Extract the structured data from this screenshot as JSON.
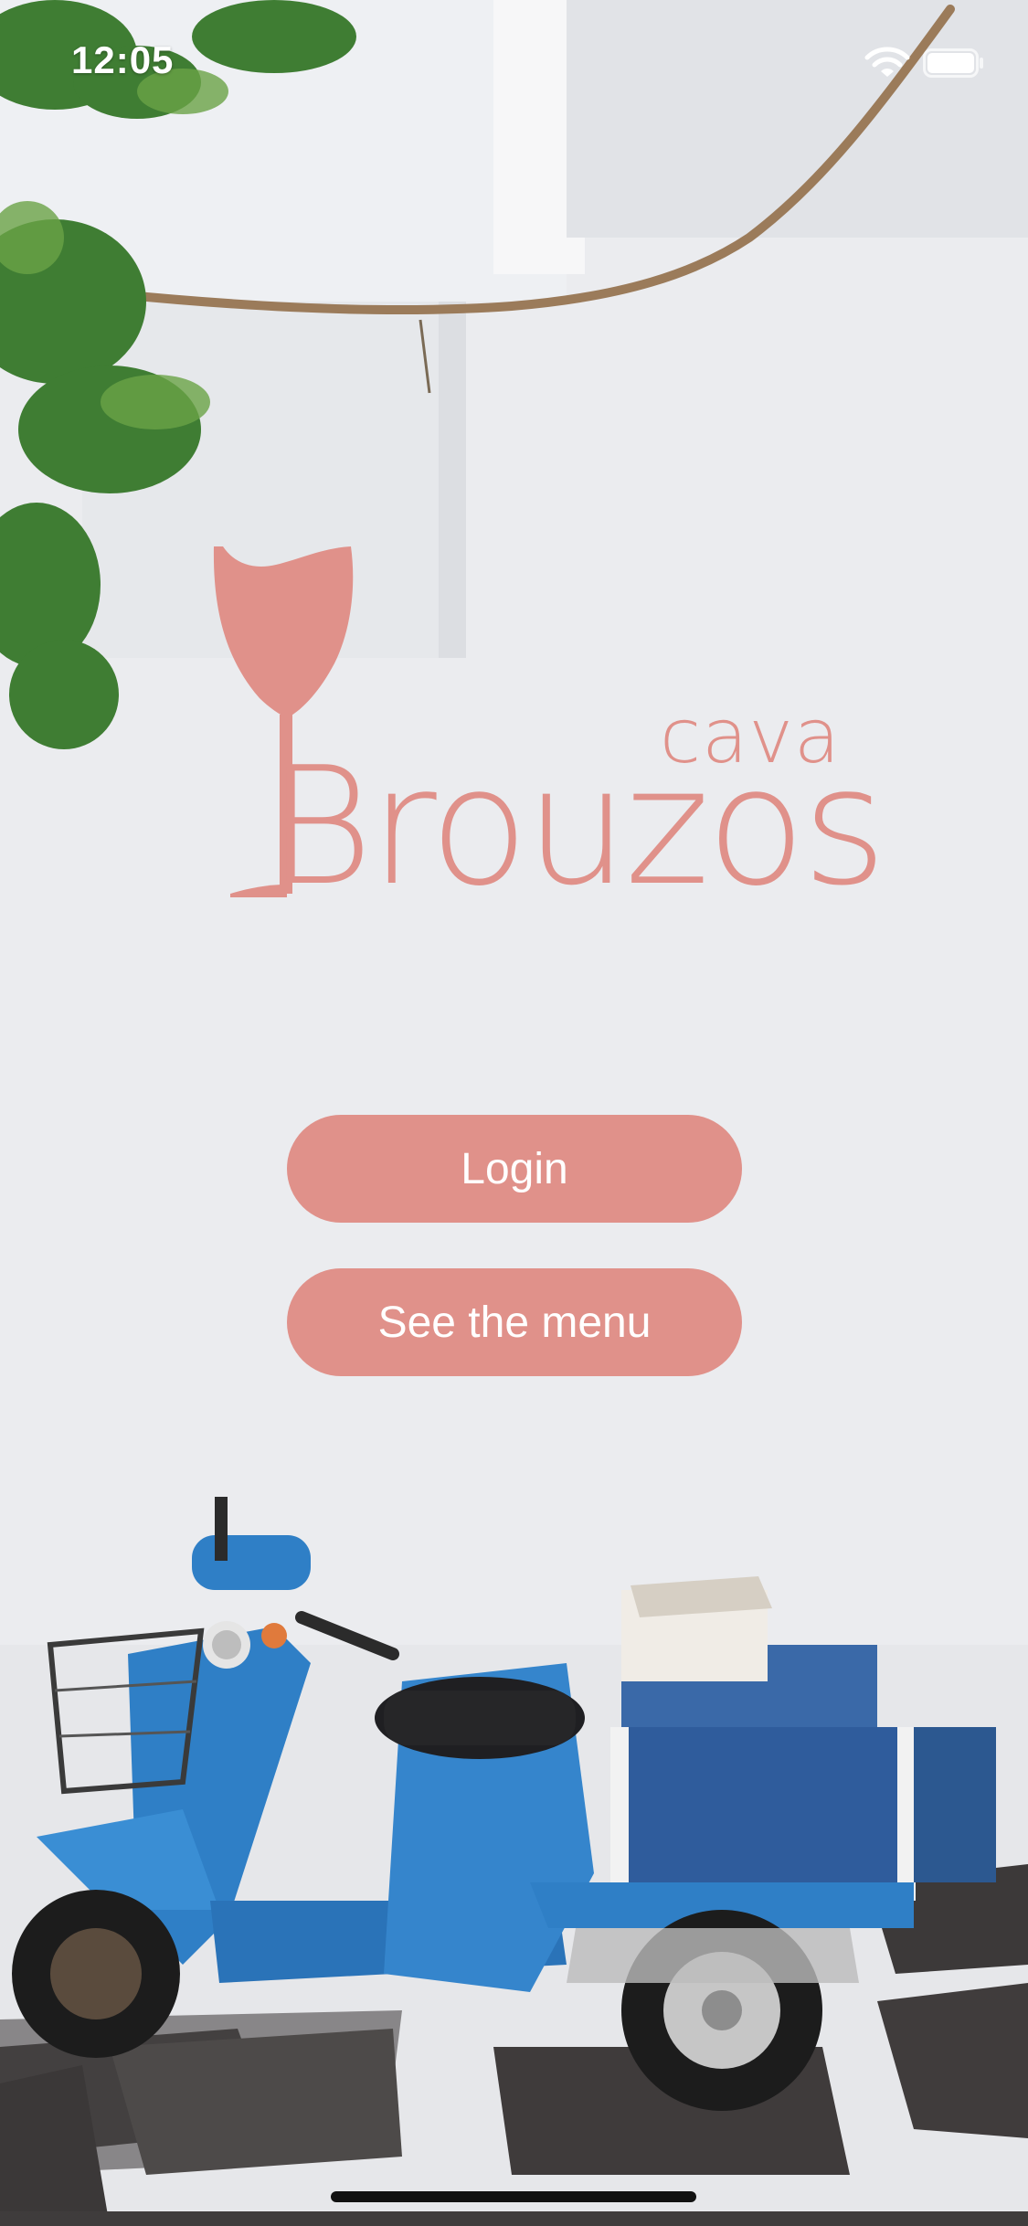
{
  "status_bar": {
    "time": "12:05",
    "icons": [
      "wifi-icon",
      "battery-icon"
    ]
  },
  "brand": {
    "subtitle": "cava",
    "name": "Brouzos",
    "logo_icon": "wine-glass-icon"
  },
  "actions": {
    "login_label": "Login",
    "menu_label": "See the menu"
  },
  "colors": {
    "accent": "#e0918a",
    "button_text": "#ffffff",
    "background_wall": "#e9ebee",
    "scooter_blue": "#2f7fc6"
  }
}
